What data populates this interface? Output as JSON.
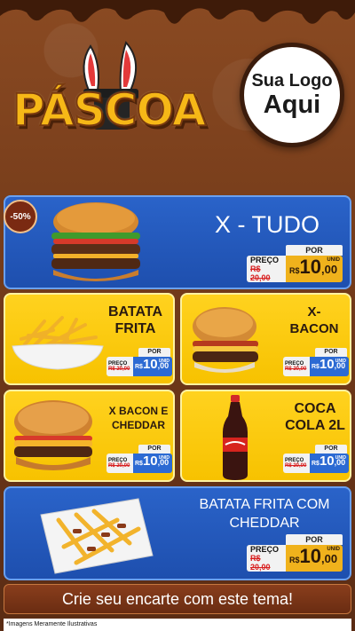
{
  "header": {
    "title": "PÁSCOA",
    "logo_line1": "Sua Logo",
    "logo_line2": "Aqui"
  },
  "items": [
    {
      "name": "X - TUDO",
      "discount": "-50%",
      "price_label": "PREÇO",
      "por_label": "POR",
      "old_price": "R$ 20,00",
      "currency": "R$",
      "price_int": "10",
      "price_dec": ",00",
      "unit": "UNID"
    },
    {
      "name_l1": "BATATA",
      "name_l2": "FRITA",
      "price_label": "PREÇO",
      "por_label": "POR",
      "old_price": "R$ 20,00",
      "currency": "R$",
      "price_int": "10",
      "price_dec": ",00",
      "unit": "UNID"
    },
    {
      "name_l1": "X-",
      "name_l2": "BACON",
      "price_label": "PREÇO",
      "por_label": "POR",
      "old_price": "R$ 20,00",
      "currency": "R$",
      "price_int": "10",
      "price_dec": ",00",
      "unit": "UNID"
    },
    {
      "name_l1": "X BACON E",
      "name_l2": "CHEDDAR",
      "price_label": "PREÇO",
      "por_label": "POR",
      "old_price": "R$ 20,00",
      "currency": "R$",
      "price_int": "10",
      "price_dec": ",00",
      "unit": "UNID"
    },
    {
      "name_l1": "COCA",
      "name_l2": "COLA 2L",
      "price_label": "PREÇO",
      "por_label": "POR",
      "old_price": "R$ 20,00",
      "currency": "R$",
      "price_int": "10",
      "price_dec": ",00",
      "unit": "UNID"
    },
    {
      "name_l1": "BATATA FRITA COM",
      "name_l2": "CHEDDAR",
      "price_label": "PREÇO",
      "por_label": "POR",
      "old_price": "R$ 20,00",
      "currency": "R$",
      "price_int": "10",
      "price_dec": ",00",
      "unit": "UNID"
    }
  ],
  "cta": "Crie seu encarte com este tema!",
  "footnote": "*Imagens Meramente Ilustrativas",
  "colors": {
    "blue_card": "#2a63c9",
    "yellow_card": "#ffd21f",
    "chocolate": "#7a3f1c",
    "gold_price": "#f0b21c"
  }
}
